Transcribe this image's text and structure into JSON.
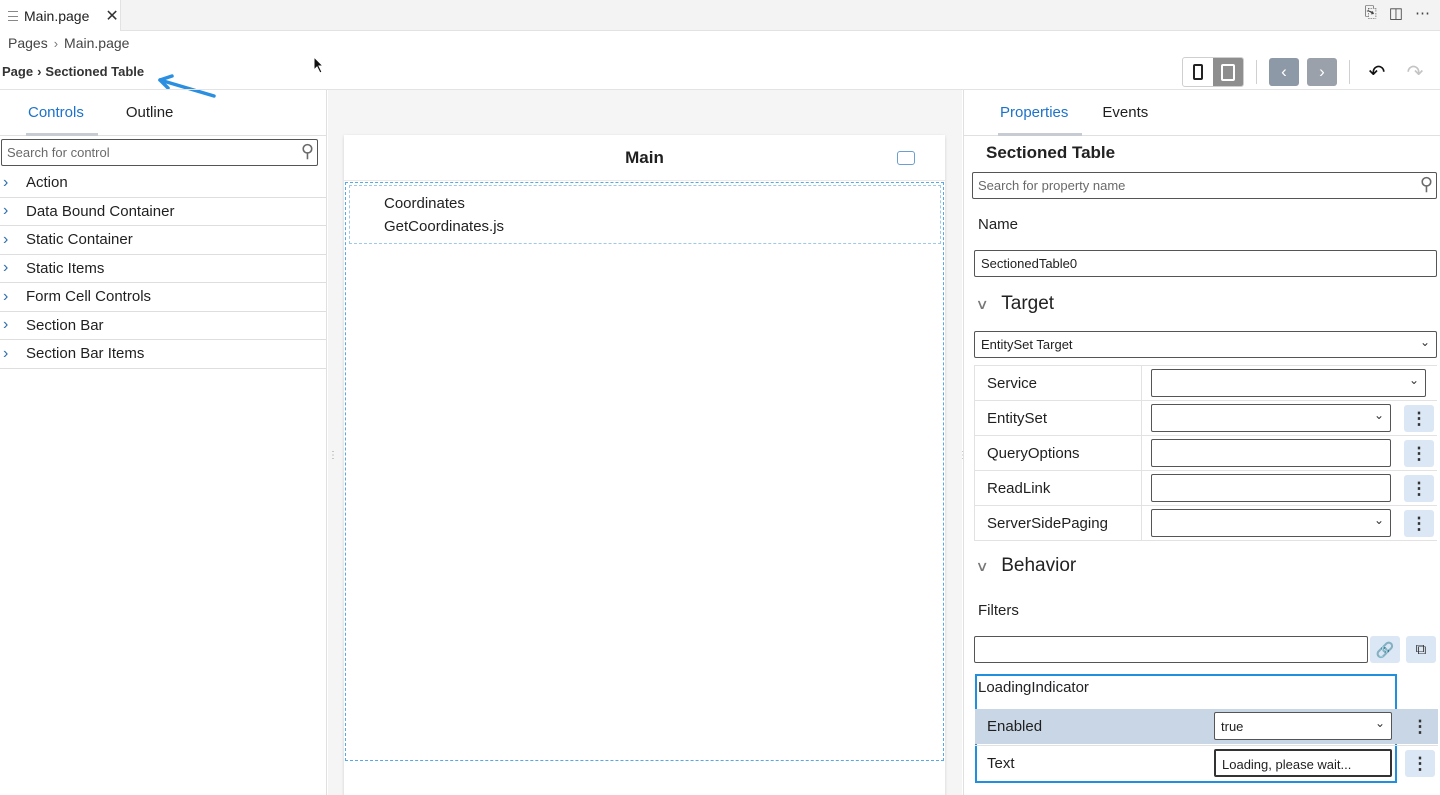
{
  "editor_tab": {
    "title": "Main.page",
    "close": "✕"
  },
  "tab_actions": [
    "⎘",
    "◫",
    "⋯"
  ],
  "breadcrumb": {
    "root": "Pages",
    "sep": "›",
    "file": "Main.page"
  },
  "page_crumb": {
    "root": "Page",
    "sep": "›",
    "current": "Sectioned Table"
  },
  "toolbar": {
    "prev": "‹",
    "next": "›",
    "undo": "↶",
    "redo": "↷"
  },
  "left_panel": {
    "tabs": [
      "Controls",
      "Outline"
    ],
    "search_placeholder": "Search for control",
    "controls": [
      "Action",
      "Data Bound Container",
      "Static Container",
      "Static Items",
      "Form Cell Controls",
      "Section Bar",
      "Section Bar Items"
    ]
  },
  "canvas": {
    "title": "Main",
    "cells": [
      "Coordinates",
      "GetCoordinates.js"
    ]
  },
  "right_panel": {
    "tabs": [
      "Properties",
      "Events"
    ],
    "title": "Sectioned Table",
    "search_placeholder": "Search for property name",
    "name_label": "Name",
    "name_value": "SectionedTable0",
    "target": {
      "heading": "Target",
      "type_value": "EntitySet Target",
      "rows": [
        {
          "label": "Service",
          "value": ""
        },
        {
          "label": "EntitySet",
          "value": ""
        },
        {
          "label": "QueryOptions",
          "value": ""
        },
        {
          "label": "ReadLink",
          "value": ""
        },
        {
          "label": "ServerSidePaging",
          "value": ""
        }
      ]
    },
    "behavior": {
      "heading": "Behavior",
      "filters_label": "Filters",
      "filters_value": "",
      "loading_indicator": {
        "label": "LoadingIndicator",
        "enabled_label": "Enabled",
        "enabled_value": "true",
        "text_label": "Text",
        "text_value": "Loading, please wait..."
      }
    }
  },
  "colors": {
    "accent": "#1d73c9",
    "highlight": "#1f8fde",
    "row_selected": "#c9d6e6",
    "kebab_bg": "#dbe7f4"
  }
}
